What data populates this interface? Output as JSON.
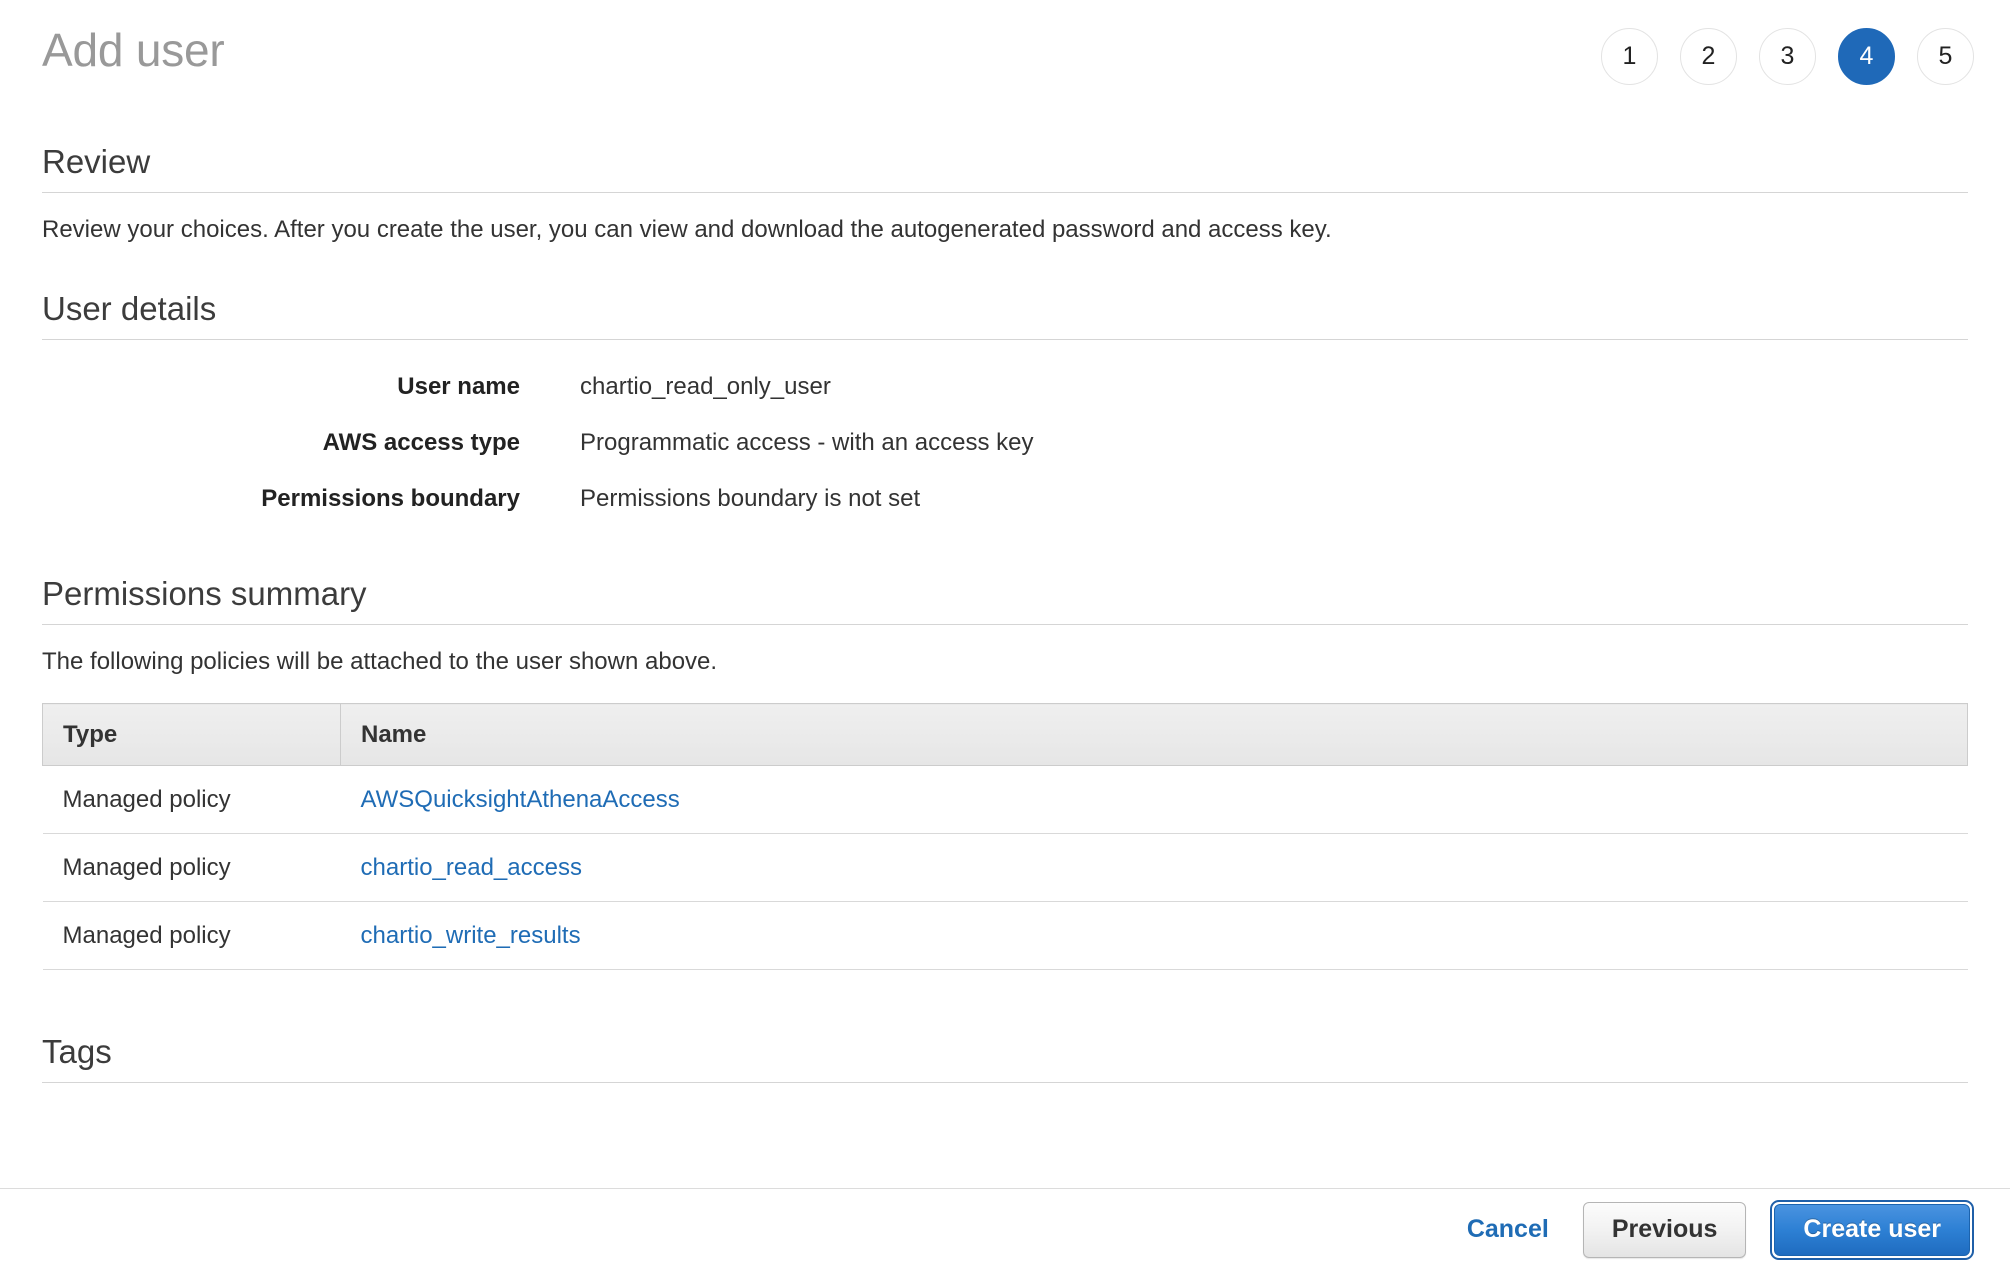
{
  "header": {
    "title": "Add user",
    "steps": [
      {
        "label": "1",
        "active": false
      },
      {
        "label": "2",
        "active": false
      },
      {
        "label": "3",
        "active": false
      },
      {
        "label": "4",
        "active": true
      },
      {
        "label": "5",
        "active": false
      }
    ]
  },
  "review": {
    "title": "Review",
    "description": "Review your choices. After you create the user, you can view and download the autogenerated password and access key."
  },
  "user_details": {
    "title": "User details",
    "rows": [
      {
        "label": "User name",
        "value": "chartio_read_only_user"
      },
      {
        "label": "AWS access type",
        "value": "Programmatic access - with an access key"
      },
      {
        "label": "Permissions boundary",
        "value": "Permissions boundary is not set"
      }
    ]
  },
  "permissions_summary": {
    "title": "Permissions summary",
    "description": "The following policies will be attached to the user shown above.",
    "columns": [
      "Type",
      "Name"
    ],
    "rows": [
      {
        "type": "Managed policy",
        "name": "AWSQuicksightAthenaAccess"
      },
      {
        "type": "Managed policy",
        "name": "chartio_read_access"
      },
      {
        "type": "Managed policy",
        "name": "chartio_write_results"
      }
    ]
  },
  "tags": {
    "title": "Tags"
  },
  "footer": {
    "cancel_label": "Cancel",
    "previous_label": "Previous",
    "create_label": "Create user"
  },
  "colors": {
    "accent_blue": "#1f69b8",
    "link_blue": "#1f6cb5",
    "title_gray": "#999999",
    "rule_gray": "#d5d5d5"
  }
}
